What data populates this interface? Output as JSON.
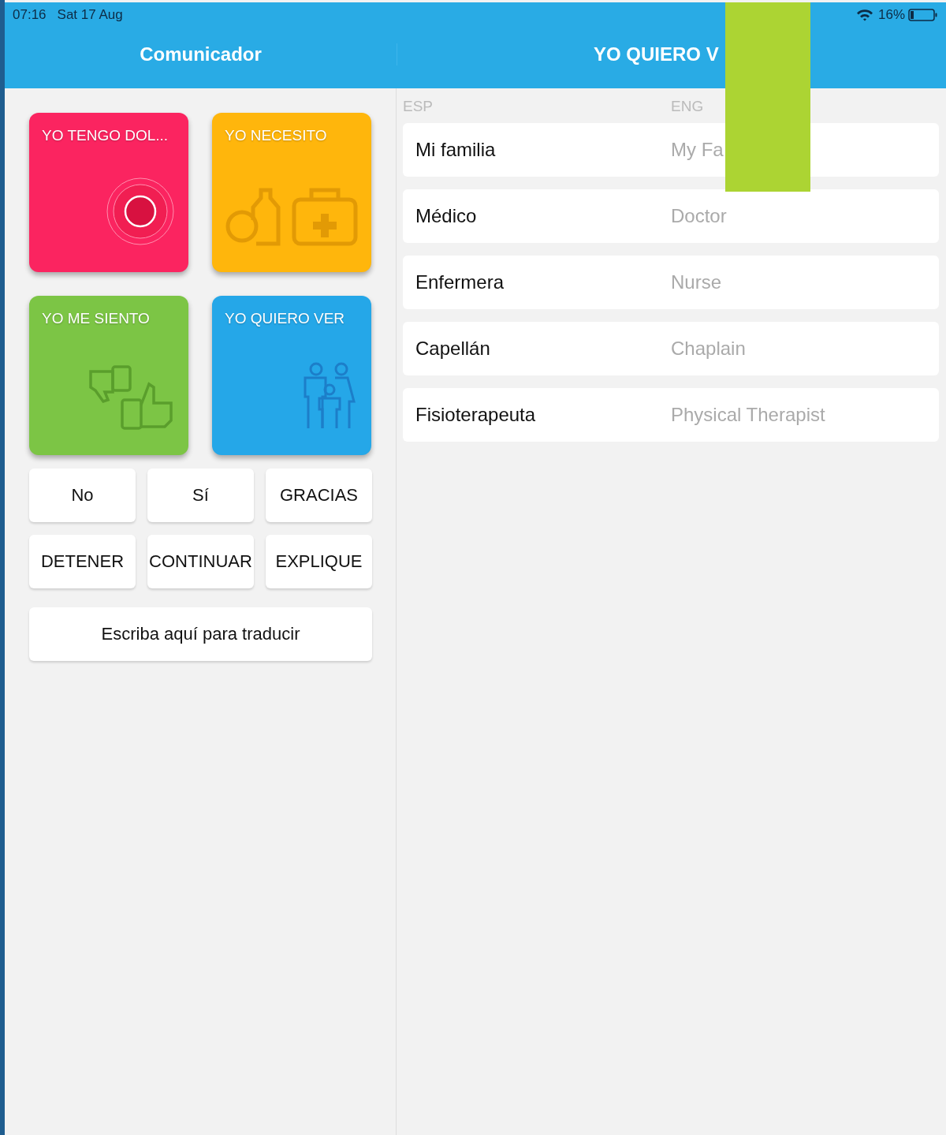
{
  "status_bar": {
    "time": "07:16",
    "date": "Sat 17 Aug",
    "battery": "16%"
  },
  "left_panel": {
    "title": "Comunicador",
    "tiles": [
      {
        "label": "YO TENGO DOL...",
        "kind": "pain",
        "color": "#fb2460"
      },
      {
        "label": "YO NECESITO",
        "kind": "needs",
        "color": "#ffb60c"
      },
      {
        "label": "YO ME SIENTO",
        "kind": "feel",
        "color": "#7cc545"
      },
      {
        "label": "YO QUIERO VER",
        "kind": "see",
        "color": "#25a7e8"
      }
    ],
    "quick_buttons": [
      "No",
      "Sí",
      "GRACIAS",
      "DETENER",
      "CONTINUAR",
      "EXPLIQUE"
    ],
    "translate_button": "Escriba aquí para traducir"
  },
  "right_panel": {
    "title": "YO QUIERO V",
    "columns": [
      "ESP",
      "ENG"
    ],
    "rows": [
      {
        "esp": "Mi familia",
        "eng": "My Fa"
      },
      {
        "esp": "Médico",
        "eng": "Doctor"
      },
      {
        "esp": "Enfermera",
        "eng": "Nurse"
      },
      {
        "esp": "Capellán",
        "eng": "Chaplain"
      },
      {
        "esp": "Fisioterapeuta",
        "eng": "Physical Therapist"
      }
    ]
  }
}
